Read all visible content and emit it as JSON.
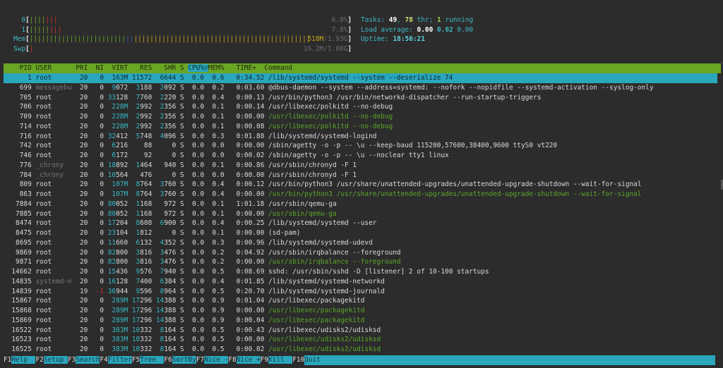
{
  "meters": {
    "cpu": [
      {
        "label": "0",
        "value": "6.0%",
        "segments": [
          {
            "color": "g",
            "fraction": 0.05
          },
          {
            "color": "r",
            "fraction": 0.04
          }
        ]
      },
      {
        "label": "1",
        "value": "7.8%",
        "segments": [
          {
            "color": "g",
            "fraction": 0.063
          },
          {
            "color": "r",
            "fraction": 0.038
          }
        ]
      }
    ],
    "mem": {
      "label": "Mem",
      "used": "518M",
      "total": "/1.93G",
      "segments": [
        {
          "color": "g",
          "fraction": 0.3
        },
        {
          "color": "b",
          "fraction": 0.025
        },
        {
          "color": "y",
          "fraction": 0.55
        }
      ]
    },
    "swap": {
      "label": "Swp",
      "value": "16.2M/1.00G",
      "segments": [
        {
          "color": "r",
          "fraction": 0.013
        }
      ]
    }
  },
  "summary": {
    "tasks_label": "Tasks: ",
    "tasks": "49",
    "sep1": ", ",
    "threads": "78",
    "thr_label": " thr; ",
    "running": "1",
    "running_label": " running",
    "load_label": "Load average: ",
    "load1": "0.00",
    "load5": "0.02",
    "load15": "0.00",
    "uptime_label": "Uptime: ",
    "uptime": "18:56:21"
  },
  "columns": {
    "pid": "PID",
    "user": "USER",
    "pri": "PRI",
    "ni": "NI",
    "virt": "VIRT",
    "res": "RES",
    "shr": "SHR",
    "s": "S",
    "cpu": "CPU%",
    "sort_indicator": "▽",
    "mem": "MEM%",
    "time": "TIME+",
    "command": "Command"
  },
  "processes": [
    {
      "pid": "1",
      "user": "root",
      "pri": "20",
      "ni": "0",
      "virt": "163M",
      "res": "11572",
      "shr": "6644",
      "s": "S",
      "cpu": "0.0",
      "mem": "0.6",
      "time": "0:34.52",
      "command": "/lib/systemd/systemd --system --deserialize 74",
      "selected": true
    },
    {
      "pid": "699",
      "user": "messagebu",
      "pri": "20",
      "ni": "0",
      "virt": "9072",
      "res": "3188",
      "shr": "2092",
      "s": "S",
      "cpu": "0.0",
      "mem": "0.2",
      "time": "0:03.60",
      "command": "@dbus-daemon --system --address=systemd: --nofork --nopidfile --systemd-activation --syslog-only",
      "dimuser": true
    },
    {
      "pid": "705",
      "user": "root",
      "pri": "20",
      "ni": "0",
      "virt": "33128",
      "res": "7760",
      "shr": "2220",
      "s": "S",
      "cpu": "0.0",
      "mem": "0.4",
      "time": "0:00.13",
      "command": "/usr/bin/python3 /usr/bin/networkd-dispatcher --run-startup-triggers"
    },
    {
      "pid": "706",
      "user": "root",
      "pri": "20",
      "ni": "0",
      "virt": "228M",
      "res": "2992",
      "shr": "2356",
      "s": "S",
      "cpu": "0.0",
      "mem": "0.1",
      "time": "0:00.14",
      "command": "/usr/libexec/polkitd --no-debug"
    },
    {
      "pid": "709",
      "user": "root",
      "pri": "20",
      "ni": "0",
      "virt": "228M",
      "res": "2992",
      "shr": "2356",
      "s": "S",
      "cpu": "0.0",
      "mem": "0.1",
      "time": "0:00.00",
      "command": "/usr/libexec/polkitd --no-debug",
      "thread": true
    },
    {
      "pid": "714",
      "user": "root",
      "pri": "20",
      "ni": "0",
      "virt": "228M",
      "res": "2992",
      "shr": "2356",
      "s": "S",
      "cpu": "0.0",
      "mem": "0.1",
      "time": "0:00.08",
      "command": "/usr/libexec/polkitd --no-debug",
      "thread": true
    },
    {
      "pid": "716",
      "user": "root",
      "pri": "20",
      "ni": "0",
      "virt": "32412",
      "res": "5748",
      "shr": "4096",
      "s": "S",
      "cpu": "0.0",
      "mem": "0.3",
      "time": "0:01.88",
      "command": "/lib/systemd/systemd-logind"
    },
    {
      "pid": "742",
      "user": "root",
      "pri": "20",
      "ni": "0",
      "virt": "6216",
      "res": "88",
      "shr": "0",
      "s": "S",
      "cpu": "0.0",
      "mem": "0.0",
      "time": "0:00.00",
      "command": "/sbin/agetty -o -p -- \\u --keep-baud 115200,57600,38400,9600 ttyS0 vt220"
    },
    {
      "pid": "746",
      "user": "root",
      "pri": "20",
      "ni": "0",
      "virt": "6172",
      "res": "92",
      "shr": "0",
      "s": "S",
      "cpu": "0.0",
      "mem": "0.0",
      "time": "0:00.02",
      "command": "/sbin/agetty -o -p -- \\u --noclear tty1 linux"
    },
    {
      "pid": "776",
      "user": "_chrony",
      "pri": "20",
      "ni": "0",
      "virt": "18892",
      "res": "1464",
      "shr": "940",
      "s": "S",
      "cpu": "0.0",
      "mem": "0.1",
      "time": "0:00.86",
      "command": "/usr/sbin/chronyd -F 1",
      "dimuser": true
    },
    {
      "pid": "784",
      "user": "_chrony",
      "pri": "20",
      "ni": "0",
      "virt": "10564",
      "res": "476",
      "shr": "0",
      "s": "S",
      "cpu": "0.0",
      "mem": "0.0",
      "time": "0:00.00",
      "command": "/usr/sbin/chronyd -F 1",
      "dimuser": true
    },
    {
      "pid": "809",
      "user": "root",
      "pri": "20",
      "ni": "0",
      "virt": "107M",
      "res": "8764",
      "shr": "3760",
      "s": "S",
      "cpu": "0.0",
      "mem": "0.4",
      "time": "0:00.12",
      "command": "/usr/bin/python3 /usr/share/unattended-upgrades/unattended-upgrade-shutdown --wait-for-signal"
    },
    {
      "pid": "863",
      "user": "root",
      "pri": "20",
      "ni": "0",
      "virt": "107M",
      "res": "8764",
      "shr": "3760",
      "s": "S",
      "cpu": "0.0",
      "mem": "0.4",
      "time": "0:00.00",
      "command": "/usr/bin/python3 /usr/share/unattended-upgrades/unattended-upgrade-shutdown --wait-for-signal",
      "thread": true
    },
    {
      "pid": "7884",
      "user": "root",
      "pri": "20",
      "ni": "0",
      "virt": "80052",
      "res": "1168",
      "shr": "972",
      "s": "S",
      "cpu": "0.0",
      "mem": "0.1",
      "time": "1:01.18",
      "command": "/usr/sbin/qemu-ga"
    },
    {
      "pid": "7885",
      "user": "root",
      "pri": "20",
      "ni": "0",
      "virt": "80052",
      "res": "1168",
      "shr": "972",
      "s": "S",
      "cpu": "0.0",
      "mem": "0.1",
      "time": "0:00.00",
      "command": "/usr/sbin/qemu-ga",
      "thread": true
    },
    {
      "pid": "8474",
      "user": "root",
      "pri": "20",
      "ni": "0",
      "virt": "17204",
      "res": "8608",
      "shr": "6900",
      "s": "S",
      "cpu": "0.0",
      "mem": "0.4",
      "time": "0:00.25",
      "command": "/lib/systemd/systemd --user"
    },
    {
      "pid": "8475",
      "user": "root",
      "pri": "20",
      "ni": "0",
      "virt": "23104",
      "res": "1812",
      "shr": "0",
      "s": "S",
      "cpu": "0.0",
      "mem": "0.1",
      "time": "0:00.00",
      "command": "(sd-pam)"
    },
    {
      "pid": "8695",
      "user": "root",
      "pri": "20",
      "ni": "0",
      "virt": "11660",
      "res": "6132",
      "shr": "4352",
      "s": "S",
      "cpu": "0.0",
      "mem": "0.3",
      "time": "0:00.96",
      "command": "/lib/systemd/systemd-udevd"
    },
    {
      "pid": "9869",
      "user": "root",
      "pri": "20",
      "ni": "0",
      "virt": "82800",
      "res": "3816",
      "shr": "3476",
      "s": "S",
      "cpu": "0.0",
      "mem": "0.2",
      "time": "0:04.92",
      "command": "/usr/sbin/irqbalance --foreground"
    },
    {
      "pid": "9871",
      "user": "root",
      "pri": "20",
      "ni": "0",
      "virt": "82800",
      "res": "3816",
      "shr": "3476",
      "s": "S",
      "cpu": "0.0",
      "mem": "0.2",
      "time": "0:00.00",
      "command": "/usr/sbin/irqbalance --foreground",
      "thread": true
    },
    {
      "pid": "14662",
      "user": "root",
      "pri": "20",
      "ni": "0",
      "virt": "15436",
      "res": "9576",
      "shr": "7940",
      "s": "S",
      "cpu": "0.0",
      "mem": "0.5",
      "time": "0:08.69",
      "command": "sshd: /usr/sbin/sshd -D [listener] 2 of 10-100 startups"
    },
    {
      "pid": "14835",
      "user": "systemd-n",
      "pri": "20",
      "ni": "0",
      "virt": "16128",
      "res": "7400",
      "shr": "6384",
      "s": "S",
      "cpu": "0.0",
      "mem": "0.4",
      "time": "0:01.85",
      "command": "/lib/systemd/systemd-networkd",
      "dimuser": true
    },
    {
      "pid": "14839",
      "user": "root",
      "pri": "19",
      "ni": "-1",
      "virt": "36944",
      "res": "9596",
      "shr": "8964",
      "s": "S",
      "cpu": "0.0",
      "mem": "0.5",
      "time": "0:20.70",
      "command": "/lib/systemd/systemd-journald"
    },
    {
      "pid": "15867",
      "user": "root",
      "pri": "20",
      "ni": "0",
      "virt": "289M",
      "res": "17296",
      "shr": "14388",
      "s": "S",
      "cpu": "0.0",
      "mem": "0.9",
      "time": "0:01.04",
      "command": "/usr/libexec/packagekitd"
    },
    {
      "pid": "15868",
      "user": "root",
      "pri": "20",
      "ni": "0",
      "virt": "289M",
      "res": "17296",
      "shr": "14388",
      "s": "S",
      "cpu": "0.0",
      "mem": "0.9",
      "time": "0:00.00",
      "command": "/usr/libexec/packagekitd",
      "thread": true
    },
    {
      "pid": "15869",
      "user": "root",
      "pri": "20",
      "ni": "0",
      "virt": "289M",
      "res": "17296",
      "shr": "14388",
      "s": "S",
      "cpu": "0.0",
      "mem": "0.9",
      "time": "0:00.04",
      "command": "/usr/libexec/packagekitd",
      "thread": true
    },
    {
      "pid": "16522",
      "user": "root",
      "pri": "20",
      "ni": "0",
      "virt": "383M",
      "res": "10332",
      "shr": "8164",
      "s": "S",
      "cpu": "0.0",
      "mem": "0.5",
      "time": "0:00.43",
      "command": "/usr/libexec/udisks2/udisksd"
    },
    {
      "pid": "16523",
      "user": "root",
      "pri": "20",
      "ni": "0",
      "virt": "383M",
      "res": "10332",
      "shr": "8164",
      "s": "S",
      "cpu": "0.0",
      "mem": "0.5",
      "time": "0:00.00",
      "command": "/usr/libexec/udisks2/udisksd",
      "thread": true
    },
    {
      "pid": "16525",
      "user": "root",
      "pri": "20",
      "ni": "0",
      "virt": "383M",
      "res": "10332",
      "shr": "8164",
      "s": "S",
      "cpu": "0.0",
      "mem": "0.5",
      "time": "0:00.02",
      "command": "/usr/libexec/udisks2/udisksd",
      "thread": true
    }
  ],
  "footer": [
    {
      "key": "F1",
      "label": "Help  "
    },
    {
      "key": "F2",
      "label": "Setup "
    },
    {
      "key": "F3",
      "label": "Search"
    },
    {
      "key": "F4",
      "label": "Filter"
    },
    {
      "key": "F5",
      "label": "Tree  "
    },
    {
      "key": "F6",
      "label": "SortBy"
    },
    {
      "key": "F7",
      "label": "Nice -"
    },
    {
      "key": "F8",
      "label": "Nice +"
    },
    {
      "key": "F9",
      "label": "Kill  "
    },
    {
      "key": "F10",
      "label": "Quit"
    }
  ]
}
